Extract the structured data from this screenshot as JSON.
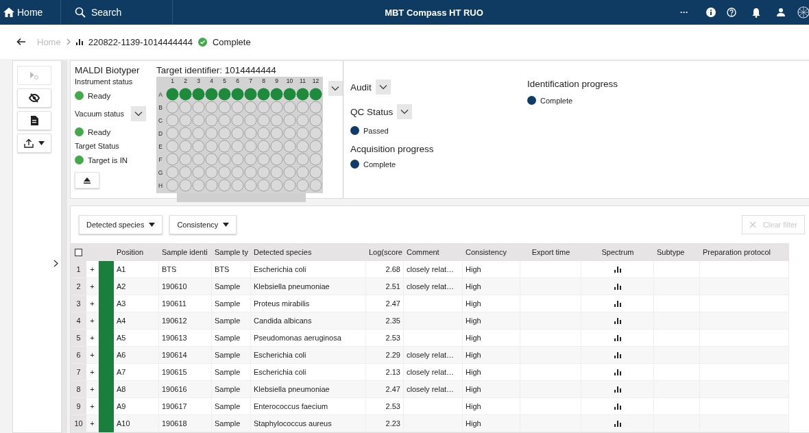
{
  "top_bar": {
    "home": "Home",
    "search": "Search",
    "title": "MBT Compass HT RUO",
    "more": "···"
  },
  "breadcrumb": {
    "home": "Home",
    "run": "220822-1139-1014444444",
    "status": "Complete"
  },
  "toolbar": [
    {
      "kind": "run",
      "disabled": true
    },
    {
      "kind": "hide",
      "disabled": false
    },
    {
      "kind": "document",
      "disabled": false
    },
    {
      "kind": "export",
      "disabled": false
    }
  ],
  "instrument": {
    "title": "MALDI Biotyper",
    "statuses": [
      {
        "label": "Instrument status",
        "value": "Ready",
        "color": "#43a94a",
        "dropdown": false
      },
      {
        "label": "Vacuum status",
        "value": "Ready",
        "color": "#43a94a",
        "dropdown": true
      },
      {
        "label": "Target Status",
        "value": "Target is IN",
        "color": "#43a94a",
        "dropdown": false
      }
    ]
  },
  "target": {
    "label": "Target identifier: 1014444444",
    "columns": [
      "1",
      "2",
      "3",
      "4",
      "5",
      "6",
      "7",
      "8",
      "9",
      "10",
      "11",
      "12"
    ],
    "rows": [
      {
        "label": "A",
        "filled": true
      },
      {
        "label": "B",
        "filled": false
      },
      {
        "label": "C",
        "filled": false
      },
      {
        "label": "D",
        "filled": false
      },
      {
        "label": "E",
        "filled": false
      },
      {
        "label": "F",
        "filled": false
      },
      {
        "label": "G",
        "filled": false
      },
      {
        "label": "H",
        "filled": false
      }
    ]
  },
  "qc": [
    {
      "label": "Audit",
      "dropdown": true
    },
    {
      "label": "QC Status",
      "dropdown": true,
      "value": "Passed",
      "color": "#0d3c68"
    },
    {
      "label": "Acquisition progress",
      "dropdown": false,
      "value": "Complete",
      "color": "#0d3c68"
    }
  ],
  "identification": {
    "label": "Identification progress",
    "value": "Complete",
    "color": "#0d3c68"
  },
  "filters": [
    {
      "label": "Detected species"
    },
    {
      "label": "Consistency"
    }
  ],
  "clear_filter": {
    "label": "Clear filter",
    "disabled": true
  },
  "table": {
    "select_all": {
      "checked": false
    },
    "columns": [
      "Position",
      "Sample identi",
      "Sample ty",
      "Detected species",
      "Log(score",
      "Comment",
      "Consistency",
      "Export time",
      "Spectrum",
      "Subtype",
      "Preparation protocol"
    ],
    "rows": [
      {
        "index": "1",
        "expand": "+",
        "color": "#1a7f3c",
        "position": "A1",
        "sample_id": "BTS",
        "sample_type": "BTS",
        "species": "Escherichia coli",
        "score": "2.68",
        "comment": "closely relat…",
        "consistency": "High"
      },
      {
        "index": "2",
        "expand": "+",
        "color": "#1a7f3c",
        "position": "A2",
        "sample_id": "190610",
        "sample_type": "Sample",
        "species": "Klebsiella pneumoniae",
        "score": "2.51",
        "comment": "closely relat…",
        "consistency": "High"
      },
      {
        "index": "3",
        "expand": "+",
        "color": "#1a7f3c",
        "position": "A3",
        "sample_id": "190611",
        "sample_type": "Sample",
        "species": "Proteus mirabilis",
        "score": "2.47",
        "consistency": "High"
      },
      {
        "index": "4",
        "expand": "+",
        "color": "#1a7f3c",
        "position": "A4",
        "sample_id": "190612",
        "sample_type": "Sample",
        "species": "Candida albicans",
        "score": "2.35",
        "consistency": "High"
      },
      {
        "index": "5",
        "expand": "+",
        "color": "#1a7f3c",
        "position": "A5",
        "sample_id": "190613",
        "sample_type": "Sample",
        "species": "Pseudomonas aeruginosa",
        "score": "2.53",
        "consistency": "High"
      },
      {
        "index": "6",
        "expand": "+",
        "color": "#1a7f3c",
        "position": "A6",
        "sample_id": "190614",
        "sample_type": "Sample",
        "species": "Escherichia coli",
        "score": "2.29",
        "comment": "closely relat…",
        "consistency": "High"
      },
      {
        "index": "7",
        "expand": "+",
        "color": "#1a7f3c",
        "position": "A7",
        "sample_id": "190615",
        "sample_type": "Sample",
        "species": "Escherichia coli",
        "score": "2.13",
        "comment": "closely relat…",
        "consistency": "High"
      },
      {
        "index": "8",
        "expand": "+",
        "color": "#1a7f3c",
        "position": "A8",
        "sample_id": "190616",
        "sample_type": "Sample",
        "species": "Klebsiella pneumoniae",
        "score": "2.47",
        "comment": "closely relat…",
        "consistency": "High"
      },
      {
        "index": "9",
        "expand": "+",
        "color": "#1a7f3c",
        "position": "A9",
        "sample_id": "190617",
        "sample_type": "Sample",
        "species": "Enterococcus faecium",
        "score": "2.53",
        "consistency": "High"
      },
      {
        "index": "10",
        "expand": "+",
        "color": "#1a7f3c",
        "position": "A10",
        "sample_id": "190618",
        "sample_type": "Sample",
        "species": "Staphylococcus aureus",
        "score": "2.23",
        "consistency": "High"
      }
    ]
  }
}
